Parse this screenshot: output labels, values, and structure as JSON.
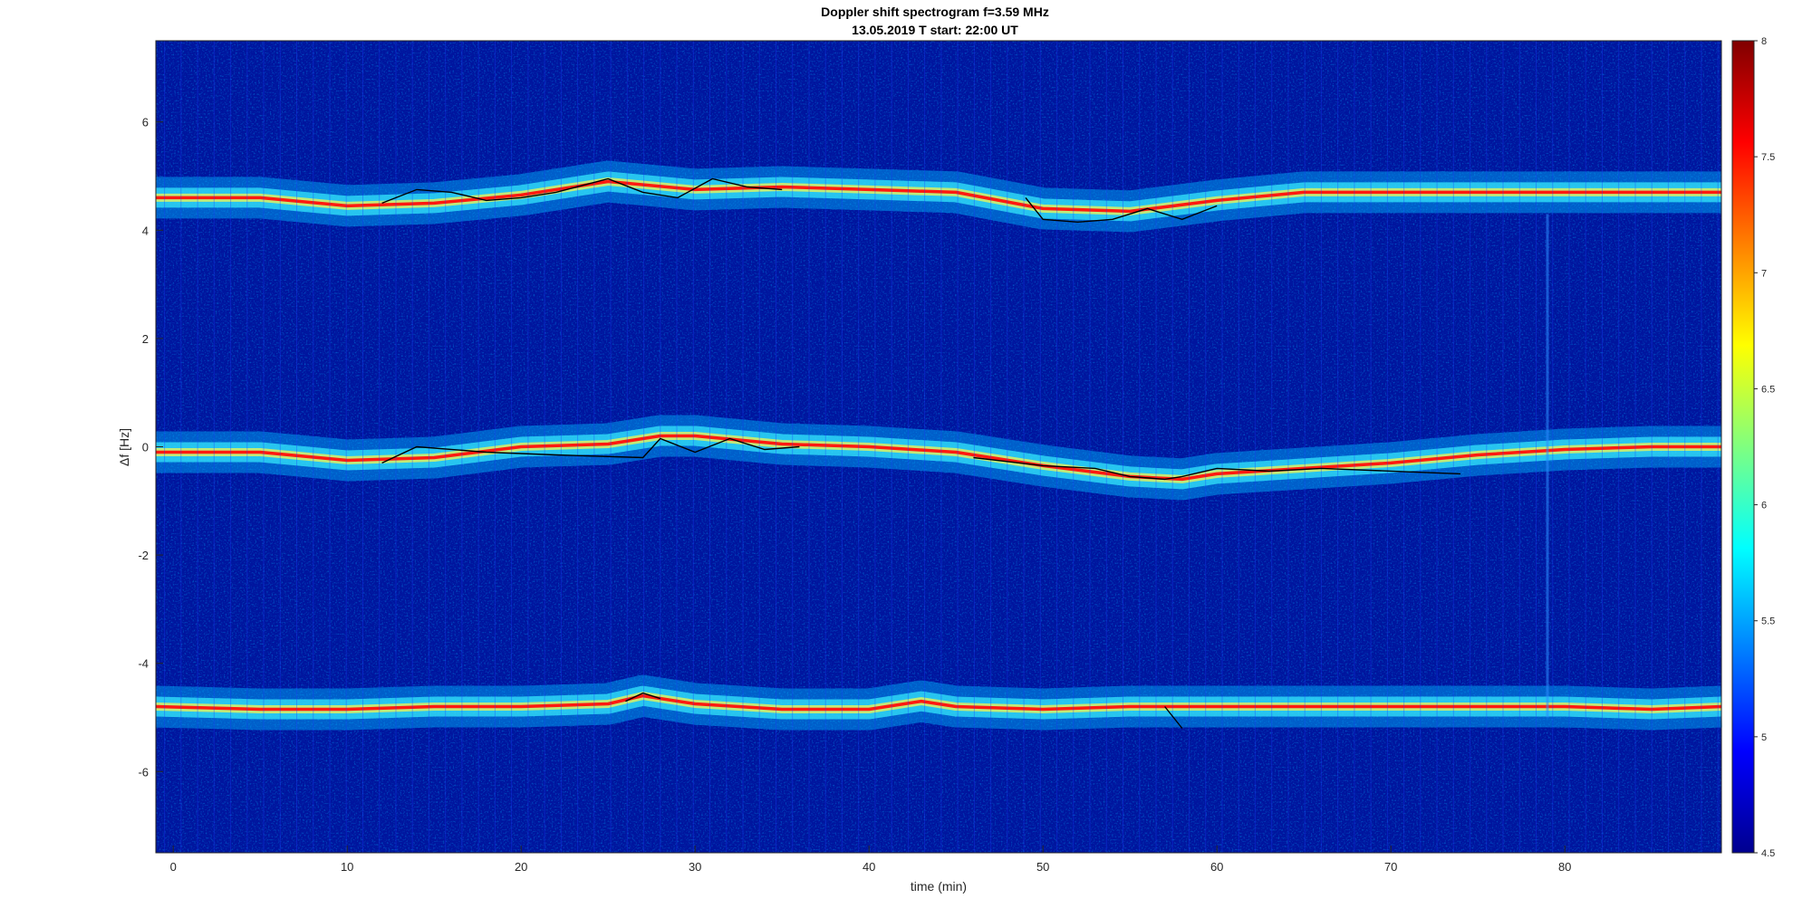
{
  "chart_data": {
    "type": "heatmap",
    "title": "Doppler shift spectrogram f=3.59 MHz",
    "subtitle": "13.05.2019   T start: 22:00 UT",
    "xlabel": "time (min)",
    "ylabel": "Δf [Hz]",
    "xlim": [
      -1,
      89
    ],
    "ylim": [
      -7.5,
      7.5
    ],
    "x_ticks": [
      0,
      10,
      20,
      30,
      40,
      50,
      60,
      70,
      80
    ],
    "y_ticks": [
      -6,
      -4,
      -2,
      0,
      2,
      4,
      6
    ],
    "colorbar": {
      "range": [
        4.5,
        8
      ],
      "ticks": [
        4.5,
        5,
        5.5,
        6,
        6.5,
        7,
        7.5,
        8
      ],
      "colormap": "jet"
    },
    "colors": {
      "background": "#00159e",
      "trace": "#000000"
    },
    "bands": [
      {
        "name": "",
        "t": [
          -1,
          5,
          10,
          15,
          20,
          25,
          30,
          35,
          40,
          45,
          50,
          55,
          60,
          65,
          70,
          75,
          80,
          85,
          89
        ],
        "df": [
          4.6,
          4.6,
          4.45,
          4.5,
          4.65,
          4.9,
          4.75,
          4.8,
          4.75,
          4.7,
          4.4,
          4.35,
          4.55,
          4.7,
          4.7,
          4.7,
          4.7,
          4.7,
          4.7
        ]
      },
      {
        "name": "",
        "t": [
          -1,
          5,
          10,
          15,
          20,
          25,
          28,
          30,
          35,
          40,
          45,
          50,
          55,
          58,
          60,
          65,
          70,
          75,
          80,
          85,
          89
        ],
        "df": [
          -0.1,
          -0.1,
          -0.25,
          -0.2,
          0.0,
          0.05,
          0.2,
          0.2,
          0.05,
          0.0,
          -0.1,
          -0.35,
          -0.55,
          -0.6,
          -0.5,
          -0.4,
          -0.3,
          -0.15,
          -0.05,
          0.0,
          0.0
        ]
      },
      {
        "name": "",
        "t": [
          -1,
          5,
          10,
          15,
          20,
          25,
          27,
          30,
          35,
          40,
          43,
          45,
          50,
          55,
          60,
          65,
          70,
          75,
          80,
          85,
          89
        ],
        "df": [
          -4.8,
          -4.85,
          -4.85,
          -4.8,
          -4.8,
          -4.75,
          -4.6,
          -4.75,
          -4.85,
          -4.85,
          -4.7,
          -4.8,
          -4.85,
          -4.8,
          -4.8,
          -4.8,
          -4.8,
          -4.8,
          -4.8,
          -4.85,
          -4.8
        ]
      }
    ],
    "traces": [
      {
        "t": [
          12,
          14,
          16,
          18,
          20,
          22,
          25,
          27,
          29,
          31,
          33,
          35
        ],
        "df": [
          4.5,
          4.75,
          4.7,
          4.55,
          4.6,
          4.7,
          4.95,
          4.7,
          4.6,
          4.95,
          4.8,
          4.75
        ]
      },
      {
        "t": [
          49,
          50,
          52,
          54,
          56,
          58,
          60
        ],
        "df": [
          4.6,
          4.2,
          4.15,
          4.2,
          4.4,
          4.2,
          4.45
        ]
      },
      {
        "t": [
          12,
          14,
          18,
          22,
          27,
          28,
          30,
          32,
          34,
          36
        ],
        "df": [
          -0.3,
          0.0,
          -0.1,
          -0.15,
          -0.2,
          0.15,
          -0.1,
          0.15,
          -0.05,
          0.0
        ]
      },
      {
        "t": [
          46,
          50,
          53,
          55,
          57,
          58,
          60,
          63,
          66,
          70,
          74
        ],
        "df": [
          -0.2,
          -0.35,
          -0.4,
          -0.55,
          -0.6,
          -0.55,
          -0.4,
          -0.45,
          -0.4,
          -0.45,
          -0.5
        ]
      },
      {
        "t": [
          26,
          27,
          28
        ],
        "df": [
          -4.7,
          -4.55,
          -4.65
        ]
      },
      {
        "t": [
          57,
          58
        ],
        "df": [
          -4.8,
          -5.2
        ]
      }
    ]
  }
}
